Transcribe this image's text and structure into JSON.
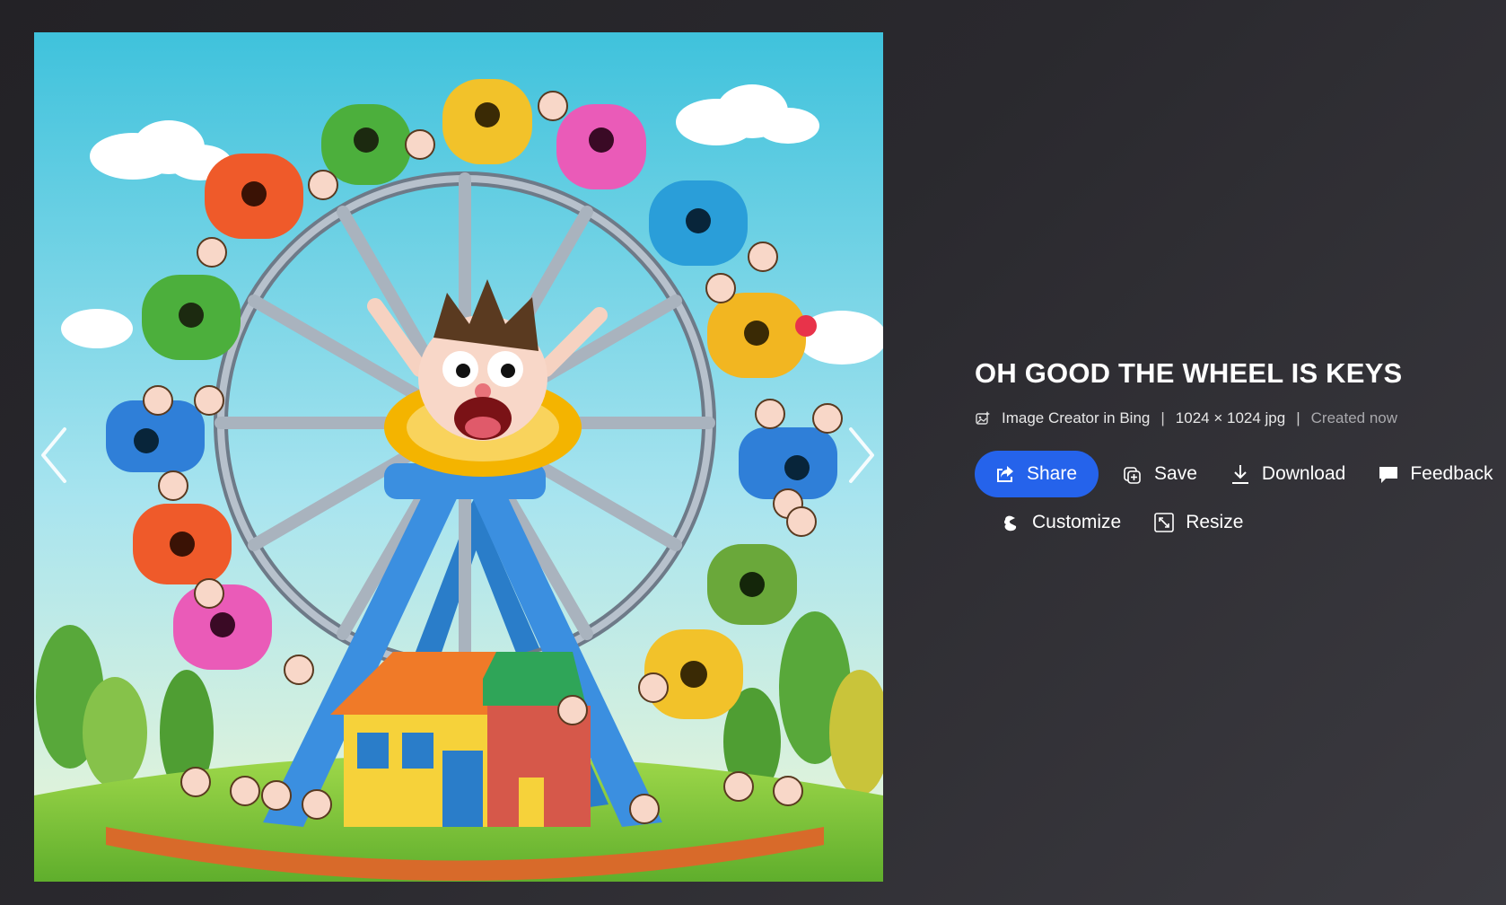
{
  "image": {
    "alt": "Cartoon ferris wheel with key-shaped gondolas",
    "prev_icon": "chevron-left-icon",
    "next_icon": "chevron-right-icon"
  },
  "details": {
    "title": "OH GOOD THE WHEEL IS KEYS",
    "source": "Image Creator in Bing",
    "dimensions": "1024 × 1024 jpg",
    "created": "Created now",
    "separator": "|"
  },
  "actions": {
    "share": "Share",
    "save": "Save",
    "download": "Download",
    "feedback": "Feedback",
    "customize": "Customize",
    "resize": "Resize"
  },
  "colors": {
    "primary": "#2563eb",
    "background": "#2a292e"
  }
}
